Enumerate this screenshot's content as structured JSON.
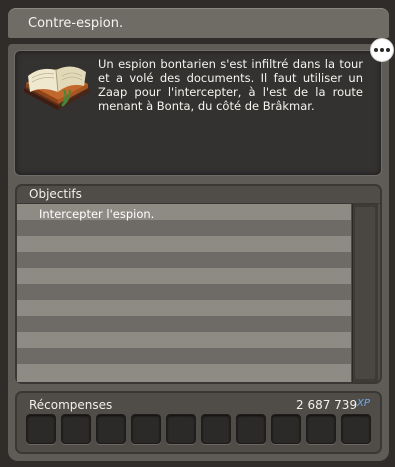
{
  "window": {
    "title": "Contre-espion."
  },
  "quest": {
    "description": "Un espion bontarien s'est infiltré dans la tour et a volé des documents. Il faut utiliser un Zaap pour l'intercepter, à l'est de la route menant à Bonta, du côté de Brâkmar.",
    "icon": "quest-book-icon"
  },
  "objectives": {
    "label": "Objectifs",
    "items": [
      "Intercepter l'espion."
    ]
  },
  "rewards": {
    "label": "Récompenses",
    "xp_value": "2 687 739",
    "xp_unit": "XP",
    "slot_count": 10
  },
  "icons": {
    "bubble": "speech-bubble-icon"
  },
  "colors": {
    "xp_accent": "#6ea9e6",
    "panel_bg": "#5f5c57",
    "row_light": "#8e8b85",
    "row_dark": "#6e6b66"
  }
}
